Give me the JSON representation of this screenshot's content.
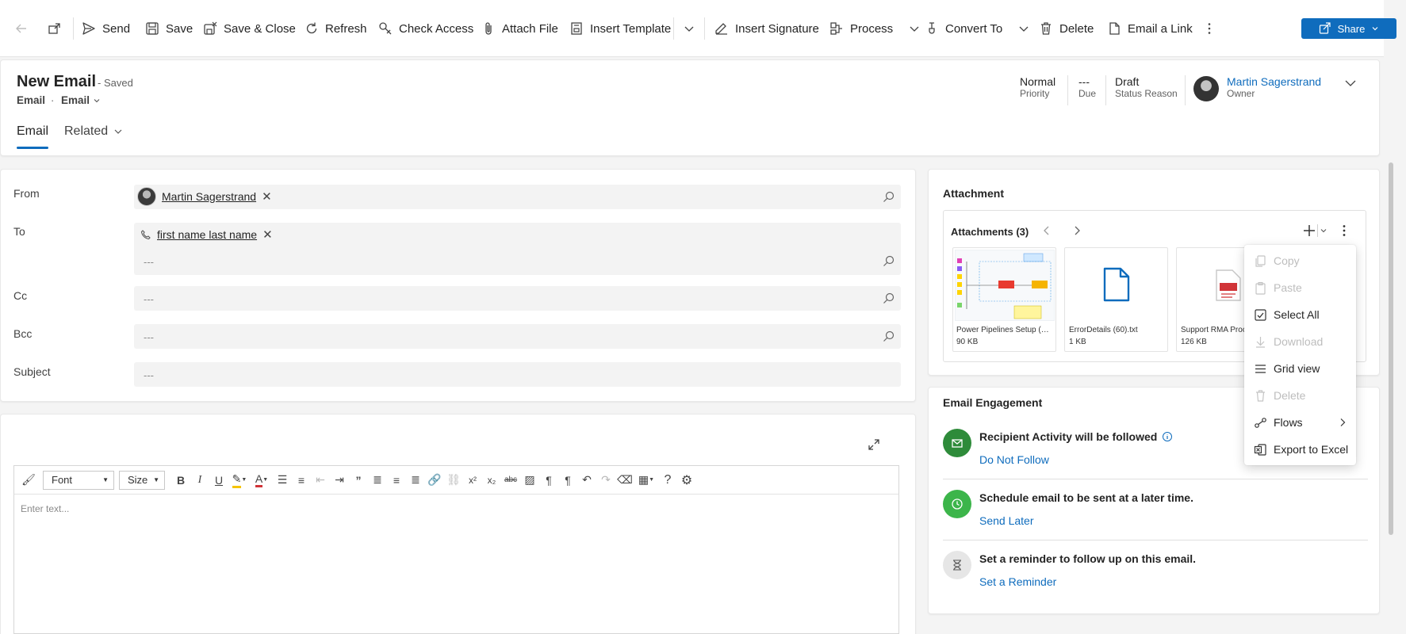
{
  "commandbar": {
    "items": [
      {
        "label": "Send",
        "icon": "send-icon"
      },
      {
        "label": "Save",
        "icon": "save-icon"
      },
      {
        "label": "Save & Close",
        "icon": "save-close-icon"
      },
      {
        "label": "Refresh",
        "icon": "refresh-icon"
      },
      {
        "label": "Check Access",
        "icon": "check-access-icon"
      },
      {
        "label": "Attach File",
        "icon": "paperclip-icon"
      },
      {
        "label": "Insert Template",
        "icon": "template-icon"
      },
      {
        "label": "Insert Signature",
        "icon": "signature-icon"
      },
      {
        "label": "Process",
        "icon": "process-icon"
      },
      {
        "label": "Convert To",
        "icon": "convert-icon"
      },
      {
        "label": "Delete",
        "icon": "trash-icon"
      },
      {
        "label": "Email a Link",
        "icon": "email-link-icon"
      }
    ],
    "share_label": "Share"
  },
  "header": {
    "title": "New Email",
    "saved_status": "- Saved",
    "entity": "Email",
    "separator": "·",
    "form_selector": "Email",
    "fields": [
      {
        "value": "Normal",
        "label": "Priority"
      },
      {
        "value": "---",
        "label": "Due"
      },
      {
        "value": "Draft",
        "label": "Status Reason"
      }
    ],
    "owner": {
      "name": "Martin Sagerstrand",
      "label": "Owner"
    },
    "tabs": [
      "Email",
      "Related"
    ]
  },
  "form": {
    "from_label": "From",
    "from_value": "Martin Sagerstrand",
    "to_label": "To",
    "to_value": "first name last name",
    "to_empty": "---",
    "cc_label": "Cc",
    "cc_value": "---",
    "bcc_label": "Bcc",
    "bcc_value": "---",
    "subject_label": "Subject",
    "subject_value": "---"
  },
  "editor": {
    "font_label": "Font",
    "size_label": "Size",
    "placeholder": "Enter text..."
  },
  "attachments": {
    "section_title": "Attachment",
    "header": "Attachments (3)",
    "files": [
      {
        "name": "Power Pipelines Setup (1)...",
        "size": "90 KB"
      },
      {
        "name": "ErrorDetails (60).txt",
        "size": "1 KB"
      },
      {
        "name": "Support RMA Proc",
        "size": "126 KB"
      }
    ]
  },
  "context_menu": {
    "items": [
      {
        "label": "Copy",
        "enabled": false
      },
      {
        "label": "Paste",
        "enabled": false
      },
      {
        "label": "Select All",
        "enabled": true
      },
      {
        "label": "Download",
        "enabled": false
      },
      {
        "label": "Grid view",
        "enabled": true
      },
      {
        "label": "Delete",
        "enabled": false
      },
      {
        "label": "Flows",
        "enabled": true
      },
      {
        "label": "Export to Excel",
        "enabled": true
      }
    ]
  },
  "engagement": {
    "title": "Email Engagement",
    "rows": [
      {
        "text": "Recipient Activity will be followed",
        "link": "Do Not Follow",
        "color": "#2e8b3a"
      },
      {
        "text": "Schedule email to be sent at a later time.",
        "link": "Send Later",
        "color": "#3cb54a"
      },
      {
        "text": "Set a reminder to follow up on this email.",
        "link": "Set a Reminder",
        "color": "#e6e6e6"
      }
    ]
  },
  "colors": {
    "accent": "#0f6cbd",
    "success": "#2e8b3a"
  }
}
